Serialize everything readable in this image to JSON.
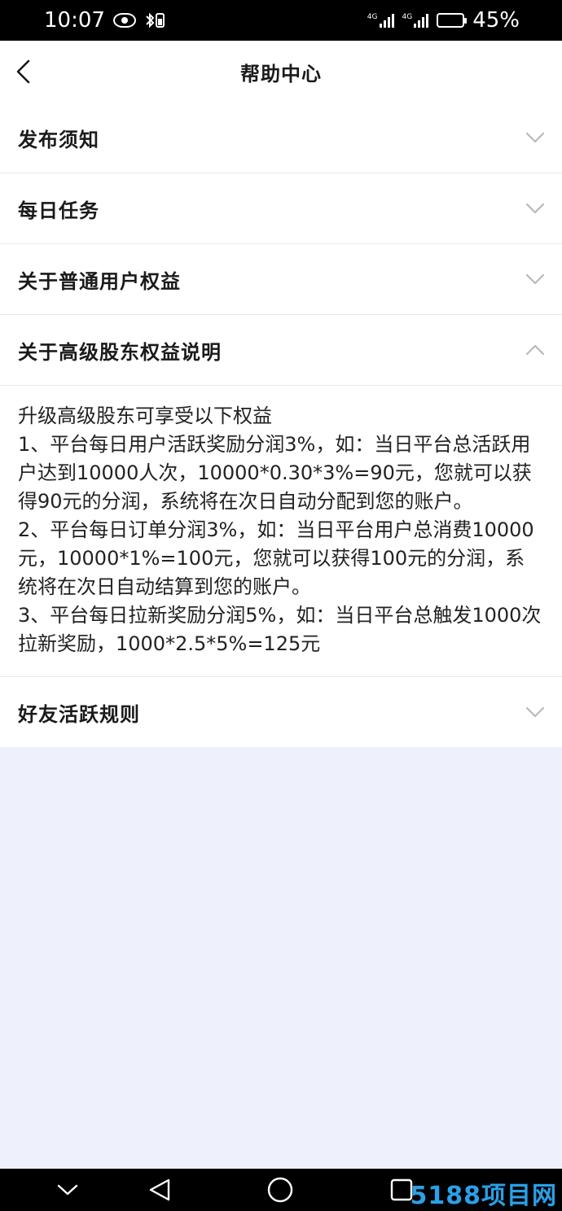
{
  "status_bar": {
    "time": "10:07",
    "battery_text": "45%",
    "battery_level": 0.45,
    "network_1": "4G",
    "network_2": "4G",
    "icons": [
      "eye-icon",
      "bluetooth-battery-icon",
      "signal-icon",
      "signal-icon",
      "battery-icon"
    ]
  },
  "header": {
    "title": "帮助中心",
    "back_icon": "chevron-left-icon"
  },
  "sections": [
    {
      "title": "发布须知",
      "expanded": false
    },
    {
      "title": "每日任务",
      "expanded": false
    },
    {
      "title": "关于普通用户权益",
      "expanded": false
    },
    {
      "title": "关于高级股东权益说明",
      "expanded": true,
      "body": [
        "升级高级股东可享受以下权益",
        "1、平台每日用户活跃奖励分润3%，如：当日平台总活跃用户达到10000人次，10000*0.30*3%=90元，您就可以获得90元的分润，系统将在次日自动分配到您的账户。",
        "2、平台每日订单分润3%，如：当日平台用户总消费10000元，10000*1%=100元，您就可以获得100元的分润，系统将在次日自动结算到您的账户。",
        "3、平台每日拉新奖励分润5%，如：当日平台总触发1000次拉新奖励，1000*2.5*5%=125元"
      ]
    },
    {
      "title": "好友活跃规则",
      "expanded": false
    }
  ],
  "nav_bar": {
    "icons": [
      "collapse-icon",
      "back-triangle-icon",
      "home-circle-icon",
      "recents-square-icon"
    ],
    "watermark": "5188项目网"
  },
  "colors": {
    "page_bg": "#eef1fb",
    "card_bg": "#ffffff",
    "chevron": "#b8b8be",
    "watermark": "#2aa0e8"
  }
}
